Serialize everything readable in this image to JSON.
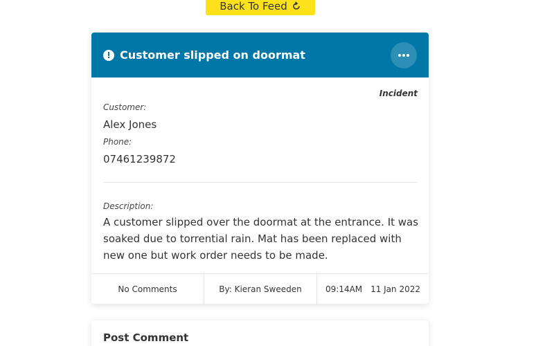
{
  "back_button": {
    "label": "Back To Feed",
    "icon": "refresh-icon"
  },
  "incident": {
    "title": "Customer slipped on doormat",
    "header_icon": "alert-icon",
    "more_icon": "ellipsis-icon",
    "type": "Incident",
    "customer_label": "Customer:",
    "customer_value": "Alex Jones",
    "phone_label": "Phone:",
    "phone_value": "07461239872",
    "description_label": "Description:",
    "description_value": "A customer slipped over the doormat at the entrance. It was soaked due to torrential rain. Mat has been replaced with new one but work order needs to be made.",
    "comments": "No Comments",
    "author": "By: Kieran Sweeden",
    "time": "09:14AM",
    "date": "11 Jan 2022"
  },
  "post_comment": {
    "title": "Post Comment"
  },
  "colors": {
    "header": "#0077a6",
    "back_button": "#fde21b"
  }
}
